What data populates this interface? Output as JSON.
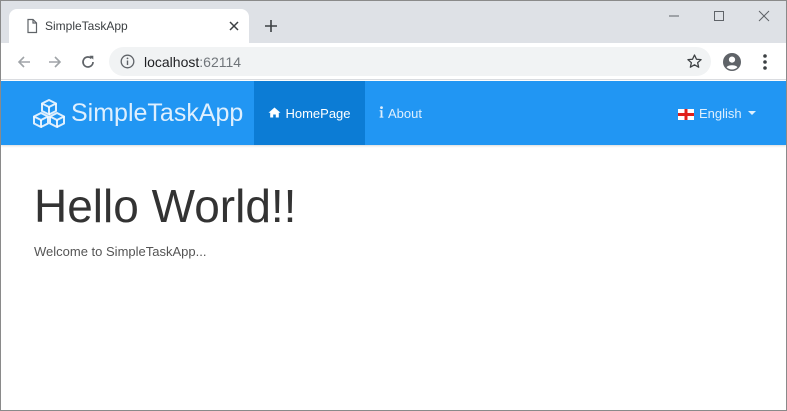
{
  "browser": {
    "tab": {
      "title": "SimpleTaskApp",
      "icon": "document-icon"
    },
    "new_tab_label": "+",
    "window_controls": [
      "minimize-icon",
      "maximize-icon",
      "close-icon"
    ],
    "address": {
      "host": "localhost",
      "port": ":62114"
    }
  },
  "app": {
    "brand": "SimpleTaskApp",
    "brand_color": "#2196f3",
    "active_color": "#0c7cd5",
    "nav": {
      "home": "HomePage",
      "about": "About",
      "language": "English"
    },
    "heading": "Hello World!!",
    "welcome": "Welcome to SimpleTaskApp..."
  }
}
